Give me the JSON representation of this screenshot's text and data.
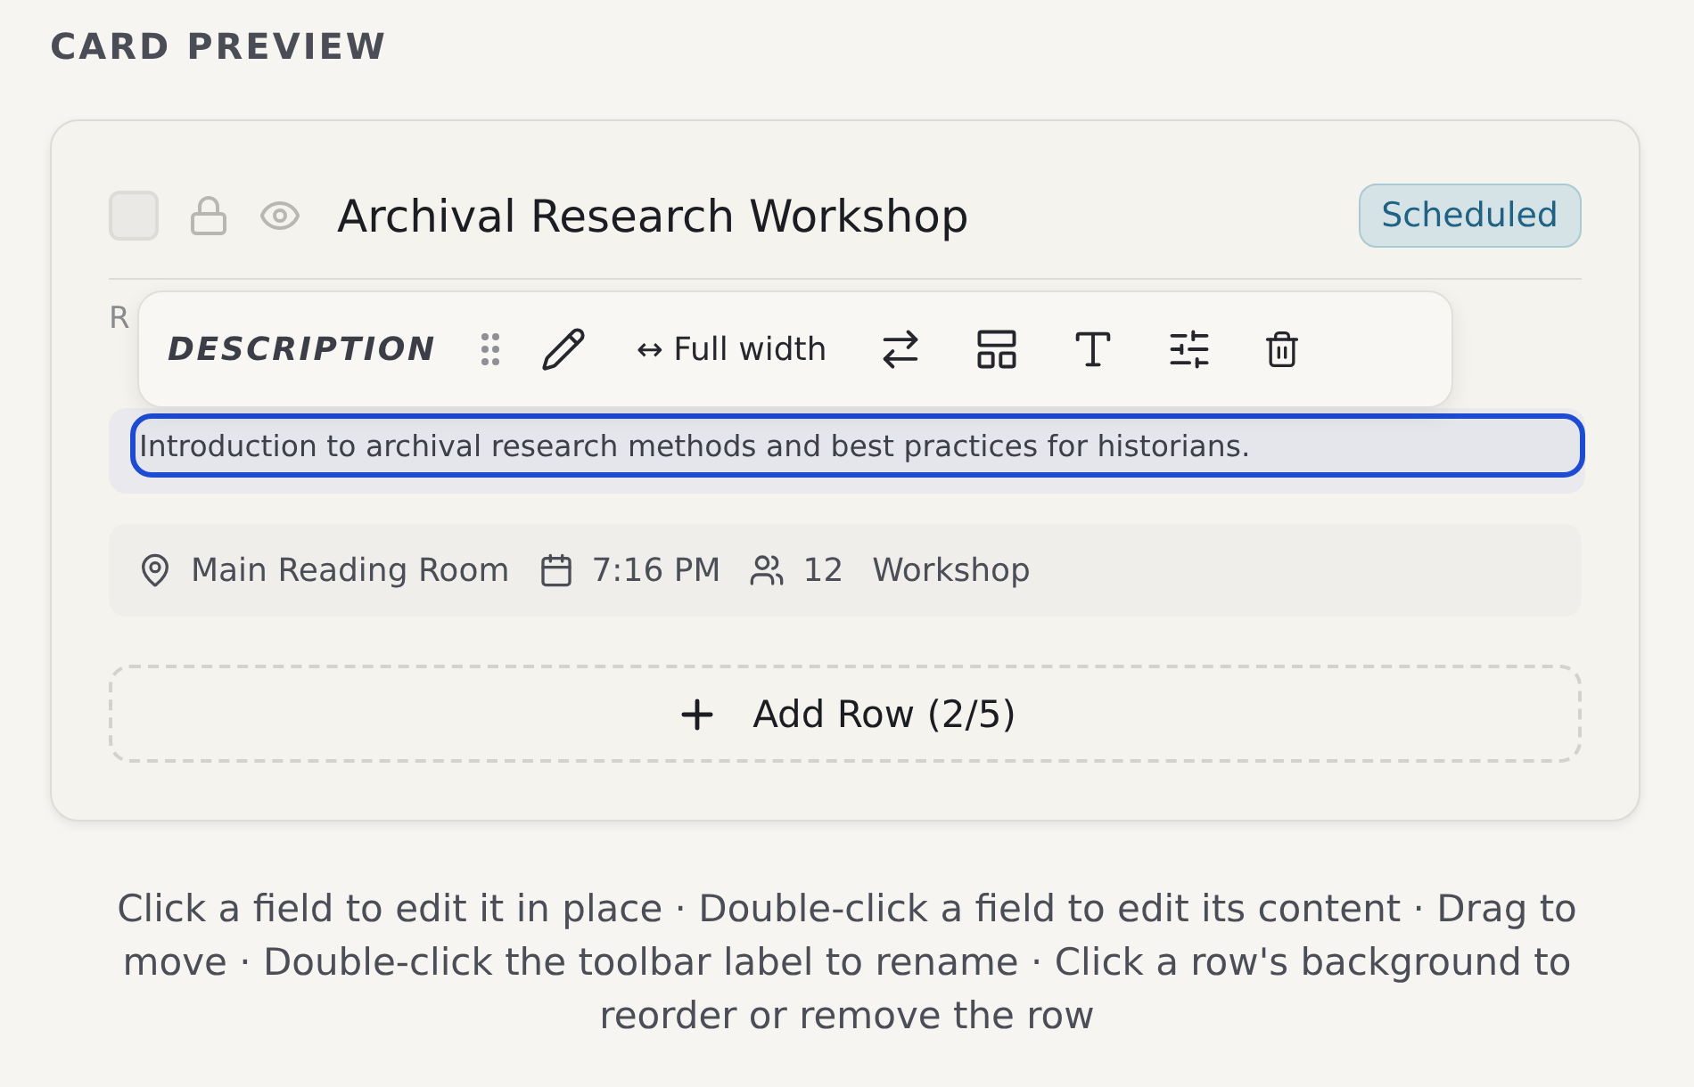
{
  "section_title": "CARD PREVIEW",
  "card": {
    "checked": false,
    "title": "Archival Research Workshop",
    "status": "Scheduled",
    "hidden_row_text": "R",
    "toolbar": {
      "label": "DESCRIPTION",
      "width_option": "↔ Full width"
    },
    "description": "Introduction to archival research methods and best practices for historians.",
    "meta": [
      {
        "kind": "location",
        "text": "Main Reading Room"
      },
      {
        "kind": "time",
        "text": "7:16 PM"
      },
      {
        "kind": "people",
        "text": "12"
      },
      {
        "kind": "plain",
        "text": "Workshop"
      }
    ],
    "add_row": "Add Row (2/5)"
  },
  "help_text": "Click a field to edit it in place · Double-click a field to edit its content · Drag to move · Double-click the toolbar label to rename · Click a row's background to reorder or remove the row"
}
